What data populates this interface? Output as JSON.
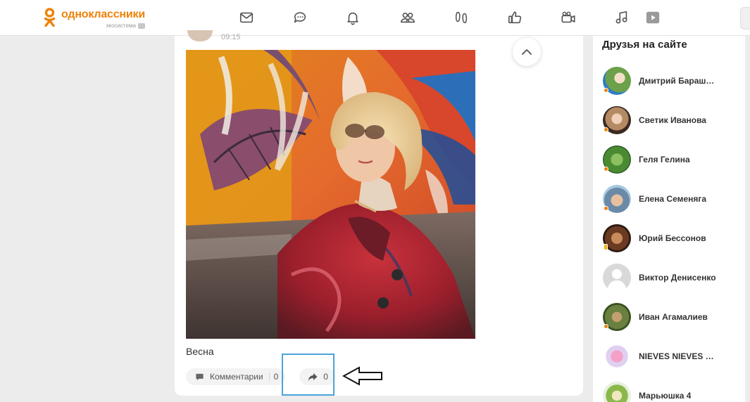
{
  "header": {
    "logo_name": "одноклассники",
    "logo_sub": "экосистема",
    "nav": [
      {
        "icon": "mail-icon",
        "title": "Сообщения"
      },
      {
        "icon": "chat-icon",
        "title": "Обсуждения"
      },
      {
        "icon": "bell-icon",
        "title": "Оповещения"
      },
      {
        "icon": "friends-icon",
        "title": "Друзья"
      },
      {
        "icon": "guests-icon",
        "title": "Гости"
      },
      {
        "icon": "like-icon",
        "title": "События"
      },
      {
        "icon": "video-icon",
        "title": "Видео"
      },
      {
        "icon": "music-icon",
        "title": "Музыка"
      },
      {
        "icon": "play-icon",
        "title": "Видео"
      }
    ]
  },
  "post": {
    "time": "09:15",
    "caption": "Весна",
    "comments_label": "Комментарии",
    "comments_count": "0",
    "share_count": "0"
  },
  "sidebar": {
    "title": "Друзья на сайте",
    "friends": [
      {
        "name": "Дмитрий Бараш…",
        "status": "online"
      },
      {
        "name": "Светик Иванова",
        "status": "online"
      },
      {
        "name": "Геля Гелина",
        "status": "online"
      },
      {
        "name": "Елена Семеняга",
        "status": "online"
      },
      {
        "name": "Юрий Бессонов",
        "status": "mobile"
      },
      {
        "name": "Виктор Денисенко",
        "status": "none"
      },
      {
        "name": "Иван Агамалиев",
        "status": "online"
      },
      {
        "name": "NIEVES NIEVES …",
        "status": "none"
      },
      {
        "name": "Марьюшка 4",
        "status": "none"
      }
    ]
  },
  "colors": {
    "brand": "#ee8208",
    "highlight": "#4aa4dc"
  }
}
